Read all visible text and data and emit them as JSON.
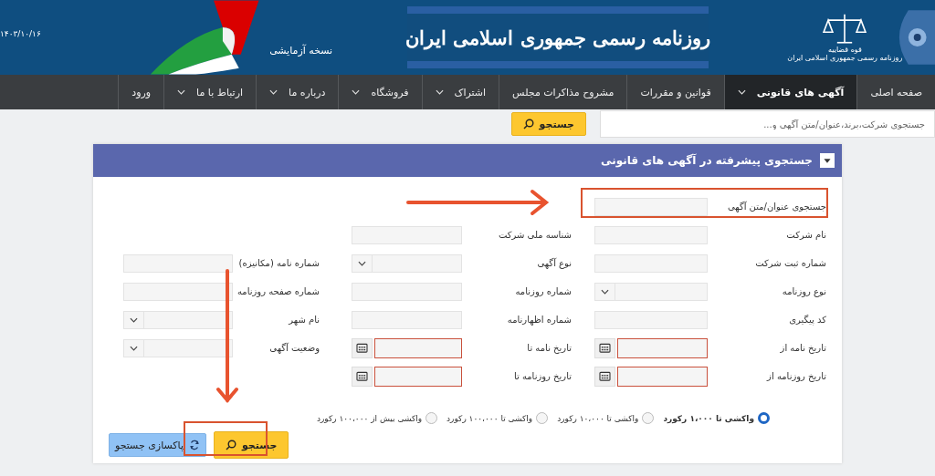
{
  "header": {
    "date": "۱۴۰۳/۱۰/۱۶",
    "edition": "نسخه آزمایشی",
    "title": "روزنامه رسمی جمهوری اسلامی ایران",
    "emblem_caption": [
      "قوه قضاییه",
      "روزنامه رسمی جمهوری اسلامی ایران"
    ]
  },
  "nav": [
    {
      "label": "صفحه اصلی",
      "selected": false,
      "dropdown": false
    },
    {
      "label": "آگهی های قانونی",
      "selected": true,
      "dropdown": true
    },
    {
      "label": "قوانین و مقررات",
      "selected": false,
      "dropdown": false
    },
    {
      "label": "مشروح مذاکرات مجلس",
      "selected": false,
      "dropdown": false
    },
    {
      "label": "اشتراک",
      "selected": false,
      "dropdown": true
    },
    {
      "label": "فروشگاه",
      "selected": false,
      "dropdown": true
    },
    {
      "label": "درباره ما",
      "selected": false,
      "dropdown": true
    },
    {
      "label": "ارتباط با ما",
      "selected": false,
      "dropdown": true
    },
    {
      "label": "ورود",
      "selected": false,
      "dropdown": false
    }
  ],
  "quick_search": {
    "placeholder": "جستجوی شرکت،برند،عنوان/متن آگهی و...",
    "button": "جستجو"
  },
  "panel": {
    "title": "جستجوی پیشرفته در آگهی های قانونی",
    "rows": [
      [
        {
          "label": "جستجوی عنوان/متن آگهی",
          "kind": "text"
        }
      ],
      [
        {
          "label": "نام شرکت",
          "kind": "text"
        },
        {
          "label": "شناسه ملی شرکت",
          "kind": "text"
        }
      ],
      [
        {
          "label": "شماره ثبت شرکت",
          "kind": "text"
        },
        {
          "label": "نوع آگهی",
          "kind": "select"
        },
        {
          "label": "شماره نامه (مکانیزه)",
          "kind": "text"
        }
      ],
      [
        {
          "label": "نوع روزنامه",
          "kind": "select"
        },
        {
          "label": "شماره روزنامه",
          "kind": "text"
        },
        {
          "label": "شماره صفحه روزنامه",
          "kind": "text"
        }
      ],
      [
        {
          "label": "کد پیگیری",
          "kind": "text"
        },
        {
          "label": "شماره اظهارنامه",
          "kind": "text"
        },
        {
          "label": "نام شهر",
          "kind": "select"
        }
      ],
      [
        {
          "label": "تاریخ نامه از",
          "kind": "date"
        },
        {
          "label": "تاریخ نامه تا",
          "kind": "date"
        },
        {
          "label": "وضعیت آگهی",
          "kind": "select"
        }
      ],
      [
        {
          "label": "تاریخ روزنامه از",
          "kind": "date"
        },
        {
          "label": "تاریخ روزنامه تا",
          "kind": "date"
        }
      ]
    ],
    "fetch_options": [
      {
        "label": "واکشی تا ۱،۰۰۰ رکورد",
        "selected": true
      },
      {
        "label": "واکشی تا ۱۰،۰۰۰ رکورد",
        "selected": false
      },
      {
        "label": "واکشی تا ۱۰۰،۰۰۰ رکورد",
        "selected": false
      },
      {
        "label": "واکشی بیش از ۱۰۰،۰۰۰ رکورد",
        "selected": false
      }
    ],
    "buttons": [
      {
        "label": "جستجو",
        "kind": "search"
      },
      {
        "label": "پاکسازی جستجو",
        "kind": "reset"
      }
    ]
  }
}
